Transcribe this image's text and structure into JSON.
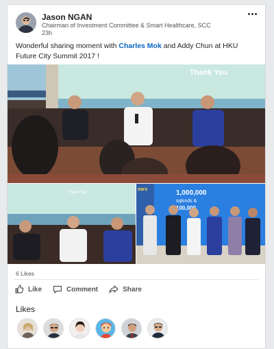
{
  "post": {
    "author": "Jason NGAN",
    "headline": "Chairman of Investment Committee & Smart Healthcare, SCC",
    "time": "23h",
    "text_before": "Wonderful sharing moment with ",
    "mention": "Charles Mok",
    "text_after": " and Addy Chun at HKU Future City Summit 2017 !",
    "slide_text": "Thank You",
    "slide_text_small": "Thank You",
    "poster_years": "ears",
    "poster_line1": "1,000,000",
    "poster_line2": "sqkinds &",
    "poster_line3": "100,000"
  },
  "likes_count": "6 Likes",
  "actions": {
    "like": "Like",
    "comment": "Comment",
    "share": "Share"
  },
  "likes_section": {
    "title": "Likes"
  },
  "colors": {
    "mention": "#0a66c2",
    "stage_floor": "#7b4b35",
    "screen": "#c8e8e0",
    "poster_blue": "#2a7fe0"
  }
}
